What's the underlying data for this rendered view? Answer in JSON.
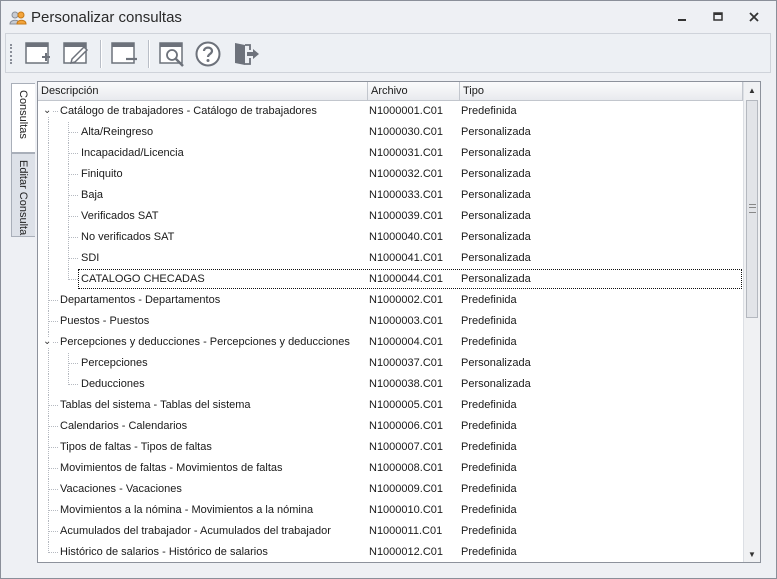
{
  "window": {
    "title": "Personalizar consultas"
  },
  "toolbar": {
    "icons": [
      "new-query-icon",
      "edit-query-icon",
      "delete-query-icon",
      "preview-query-icon",
      "help-icon",
      "exit-icon"
    ]
  },
  "side_tabs": [
    {
      "label": "Consultas"
    },
    {
      "label": "Editar Consulta"
    }
  ],
  "grid": {
    "columns": [
      "Descripción",
      "Archivo",
      "Tipo"
    ],
    "rows": [
      {
        "desc": "Catálogo de trabajadores - Catálogo de trabajadores",
        "file": "N1000001.C01",
        "type": "Predefinida"
      },
      {
        "desc": "Alta/Reingreso",
        "file": "N1000030.C01",
        "type": "Personalizada"
      },
      {
        "desc": "Incapacidad/Licencia",
        "file": "N1000031.C01",
        "type": "Personalizada"
      },
      {
        "desc": "Finiquito",
        "file": "N1000032.C01",
        "type": "Personalizada"
      },
      {
        "desc": "Baja",
        "file": "N1000033.C01",
        "type": "Personalizada"
      },
      {
        "desc": "Verificados SAT",
        "file": "N1000039.C01",
        "type": "Personalizada"
      },
      {
        "desc": "No verificados SAT",
        "file": "N1000040.C01",
        "type": "Personalizada"
      },
      {
        "desc": "SDI",
        "file": "N1000041.C01",
        "type": "Personalizada"
      },
      {
        "desc": "CATALOGO CHECADAS",
        "file": "N1000044.C01",
        "type": "Personalizada"
      },
      {
        "desc": "Departamentos - Departamentos",
        "file": "N1000002.C01",
        "type": "Predefinida"
      },
      {
        "desc": "Puestos - Puestos",
        "file": "N1000003.C01",
        "type": "Predefinida"
      },
      {
        "desc": "Percepciones y deducciones - Percepciones y deducciones",
        "file": "N1000004.C01",
        "type": "Predefinida"
      },
      {
        "desc": "Percepciones",
        "file": "N1000037.C01",
        "type": "Personalizada"
      },
      {
        "desc": "Deducciones",
        "file": "N1000038.C01",
        "type": "Personalizada"
      },
      {
        "desc": "Tablas del sistema - Tablas del sistema",
        "file": "N1000005.C01",
        "type": "Predefinida"
      },
      {
        "desc": "Calendarios - Calendarios",
        "file": "N1000006.C01",
        "type": "Predefinida"
      },
      {
        "desc": "Tipos de faltas - Tipos de faltas",
        "file": "N1000007.C01",
        "type": "Predefinida"
      },
      {
        "desc": "Movimientos de faltas - Movimientos de faltas",
        "file": "N1000008.C01",
        "type": "Predefinida"
      },
      {
        "desc": "Vacaciones - Vacaciones",
        "file": "N1000009.C01",
        "type": "Predefinida"
      },
      {
        "desc": "Movimientos a la nómina - Movimientos a la nómina",
        "file": "N1000010.C01",
        "type": "Predefinida"
      },
      {
        "desc": "Acumulados del trabajador - Acumulados del trabajador",
        "file": "N1000011.C01",
        "type": "Predefinida"
      },
      {
        "desc": "Histórico de salarios - Histórico de salarios",
        "file": "N1000012.C01",
        "type": "Predefinida"
      }
    ]
  }
}
